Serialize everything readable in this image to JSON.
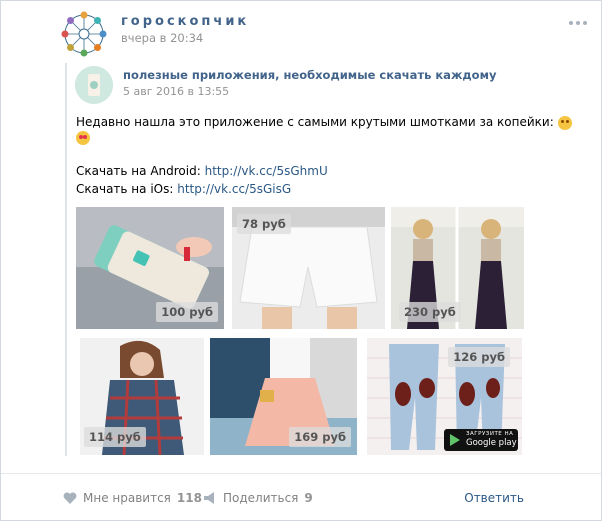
{
  "post": {
    "author": "гороскопчик",
    "time": "вчера в 20:34"
  },
  "repost": {
    "author": "полезные приложения, необходимые скачать каждому",
    "date": "5 авг 2016 в 13:55",
    "text": "Недавно нашла это приложение с самыми крутыми шмотками за копейки:",
    "android_label": "Скачать на Android:",
    "android_link": "http://vk.cc/5sGhmU",
    "ios_label": "Скачать на iOs:",
    "ios_link": "http://vk.cc/5sGisG"
  },
  "photos": [
    {
      "price": "100 руб"
    },
    {
      "price": "78 руб"
    },
    {
      "price": "230 руб"
    },
    {
      "price": "114 руб"
    },
    {
      "price": "169 руб"
    },
    {
      "price": "126 руб"
    }
  ],
  "badge": {
    "top": "ЗАГРУЗИТЕ НА",
    "store": "Google play"
  },
  "footer": {
    "like_label": "Мне нравится",
    "like_count": "118",
    "share_label": "Поделиться",
    "share_count": "9",
    "reply_label": "Ответить"
  },
  "colors": {
    "link": "#2a5885",
    "title": "#42648b",
    "muted": "#939393",
    "background": "#ffffff"
  }
}
